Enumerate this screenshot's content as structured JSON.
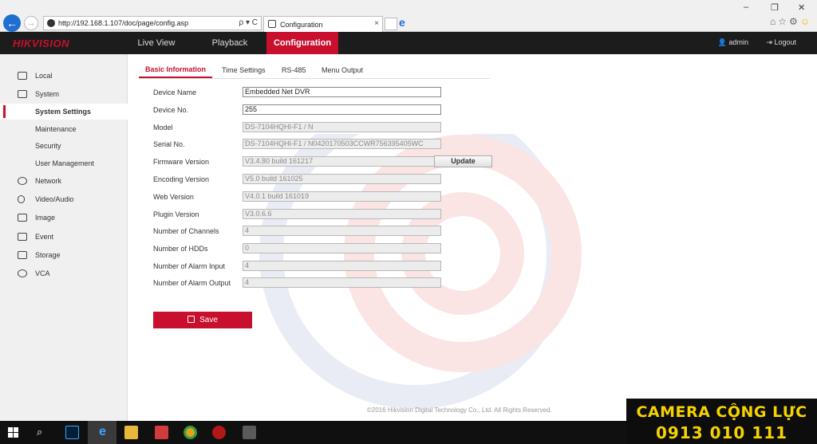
{
  "browser": {
    "url": "http://192.168.1.107/doc/page/config.asp",
    "search_glyph": "ρ ▾ C",
    "tab_title": "Configuration",
    "tab_close": "×",
    "win_min": "–",
    "win_restore": "❐",
    "win_close": "✕",
    "toolbar_icons": [
      "home-icon",
      "star-icon",
      "gear-icon",
      "smiley-icon"
    ]
  },
  "app": {
    "logo_hik": "HIK",
    "logo_vision": "VISION",
    "menu": [
      "Live View",
      "Playback",
      "Configuration"
    ],
    "active_menu": "Configuration",
    "user": "admin",
    "logout": "Logout",
    "accent_color": "#c8102e"
  },
  "sidebar": {
    "items": [
      {
        "label": "Local",
        "icon": "monitor-icon"
      },
      {
        "label": "System",
        "icon": "system-icon"
      },
      {
        "label": "System Settings",
        "active": true
      },
      {
        "label": "Maintenance"
      },
      {
        "label": "Security"
      },
      {
        "label": "User Management"
      },
      {
        "label": "Network",
        "icon": "globe-icon"
      },
      {
        "label": "Video/Audio",
        "icon": "mic-icon"
      },
      {
        "label": "Image",
        "icon": "image-icon"
      },
      {
        "label": "Event",
        "icon": "calendar-icon"
      },
      {
        "label": "Storage",
        "icon": "disk-icon"
      },
      {
        "label": "VCA",
        "icon": "vca-icon"
      }
    ]
  },
  "subtabs": [
    "Basic Information",
    "Time Settings",
    "RS-485",
    "Menu Output"
  ],
  "form": {
    "rows": [
      {
        "label": "Device Name",
        "value": "Embedded Net DVR",
        "editable": true
      },
      {
        "label": "Device No.",
        "value": "255",
        "editable": true
      },
      {
        "label": "Model",
        "value": "DS-7104HQHI-F1 / N"
      },
      {
        "label": "Serial No.",
        "value": "DS-7104HQHI-F1 / N0420170503CCWR756395405WC"
      },
      {
        "label": "Firmware Version",
        "value": "V3.4.80 build 161217"
      },
      {
        "label": "Encoding Version",
        "value": "V5.0 build 161025"
      },
      {
        "label": "Web Version",
        "value": "V4.0.1 build 161019"
      },
      {
        "label": "Plugin Version",
        "value": "V3.0.6.6"
      },
      {
        "label": "Number of Channels",
        "value": "4"
      },
      {
        "label": "Number of HDDs",
        "value": "0"
      },
      {
        "label": "Number of Alarm Input",
        "value": "4"
      },
      {
        "label": "Number of Alarm Output",
        "value": "4"
      }
    ],
    "update_label": "Update",
    "save_label": "Save"
  },
  "footer": "©2016 Hikvision Digital Technology Co., Ltd. All Rights Reserved.",
  "promo": {
    "name": "CAMERA CỘNG LỰC",
    "phone": "0913 010 111",
    "color": "#f5d300"
  },
  "taskbar": {
    "apps": [
      "start-icon",
      "search-icon",
      "photoshop-icon",
      "ie-icon",
      "folder-icon",
      "app-icon",
      "chrome-icon",
      "app2-icon",
      "app3-icon"
    ]
  }
}
